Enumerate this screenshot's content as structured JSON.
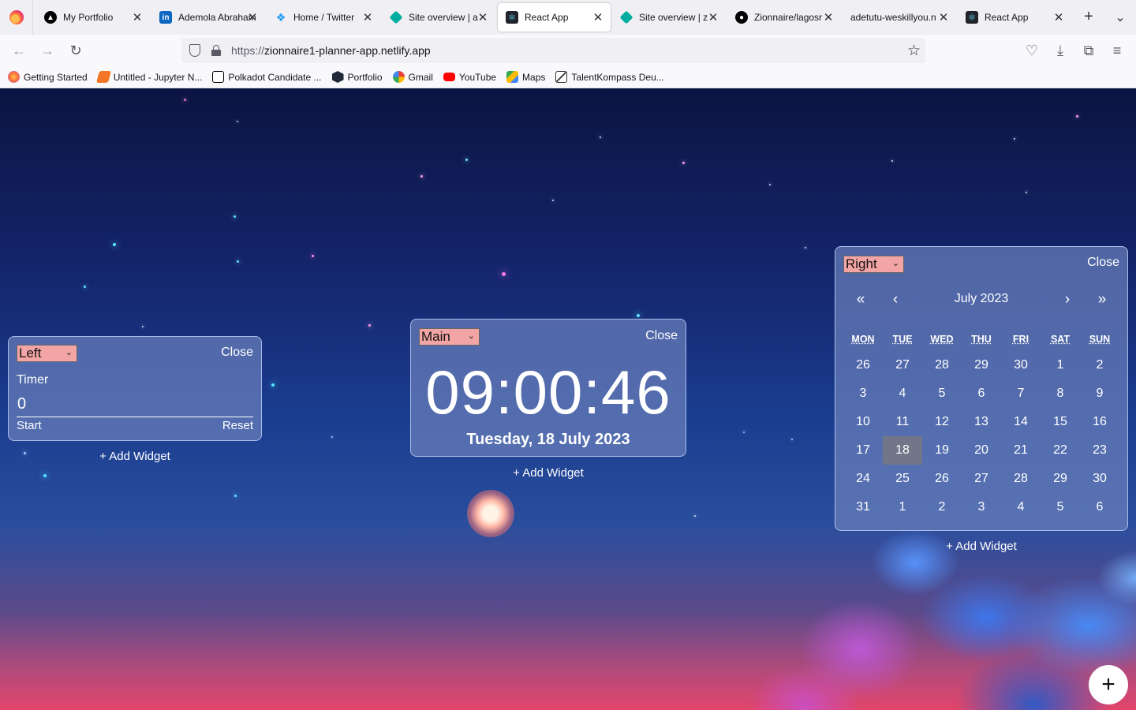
{
  "browser": {
    "tabs": [
      {
        "title": "My Portfolio",
        "favicon_color": "#000000"
      },
      {
        "title": "Ademola Abraham",
        "favicon_color": "#0a66c2"
      },
      {
        "title": "Home / Twitter",
        "favicon_color": "#1d9bf0"
      },
      {
        "title": "Site overview | a",
        "favicon_color": "#00ad9f"
      },
      {
        "title": "React App",
        "favicon_color": "#20232a",
        "active": true
      },
      {
        "title": "Site overview | z",
        "favicon_color": "#00ad9f"
      },
      {
        "title": "Zionnaire/lagosr",
        "favicon_color": "#000000"
      },
      {
        "title": "adetutu-weskillyou.n",
        "favicon_color": ""
      },
      {
        "title": "React App",
        "favicon_color": "#20232a"
      }
    ],
    "url_protocol": "https://",
    "url_host": "zionnaire1-planner-app.netlify.app",
    "bookmarks": [
      {
        "label": "Getting Started",
        "color": "#ff7139"
      },
      {
        "label": "Untitled - Jupyter N...",
        "color": "#f37626"
      },
      {
        "label": "Polkadot Candidate ...",
        "color": "#000000"
      },
      {
        "label": "Portfolio",
        "color": "#1f2937"
      },
      {
        "label": "Gmail",
        "color": "#4285f4"
      },
      {
        "label": "YouTube",
        "color": "#ff0000"
      },
      {
        "label": "Maps",
        "color": "#34a853"
      },
      {
        "label": "TalentKompass Deu...",
        "color": "#333333"
      }
    ]
  },
  "widgets": {
    "left": {
      "position": "Left",
      "close_label": "Close",
      "title": "Timer",
      "value": "0",
      "start_label": "Start",
      "reset_label": "Reset",
      "add_label": "+ Add Widget"
    },
    "main": {
      "position": "Main",
      "close_label": "Close",
      "time": "09:00:46",
      "date": "Tuesday, 18 July 2023",
      "add_label": "+ Add Widget"
    },
    "right": {
      "position": "Right",
      "close_label": "Close",
      "nav": {
        "prev_year": "«",
        "prev_month": "‹",
        "next_month": "›",
        "next_year": "»"
      },
      "month_label": "July 2023",
      "weekdays": [
        "MON",
        "TUE",
        "WED",
        "THU",
        "FRI",
        "SAT",
        "SUN"
      ],
      "weeks": [
        [
          "26",
          "27",
          "28",
          "29",
          "30",
          "1",
          "2"
        ],
        [
          "3",
          "4",
          "5",
          "6",
          "7",
          "8",
          "9"
        ],
        [
          "10",
          "11",
          "12",
          "13",
          "14",
          "15",
          "16"
        ],
        [
          "17",
          "18",
          "19",
          "20",
          "21",
          "22",
          "23"
        ],
        [
          "24",
          "25",
          "26",
          "27",
          "28",
          "29",
          "30"
        ],
        [
          "31",
          "1",
          "2",
          "3",
          "4",
          "5",
          "6"
        ]
      ],
      "today": "18",
      "add_label": "+ Add Widget"
    }
  },
  "fab_label": "+",
  "colors": {
    "select_bg": "#f3a5a5",
    "widget_bg": "#6a7fbb",
    "today_bg": "#787882"
  }
}
